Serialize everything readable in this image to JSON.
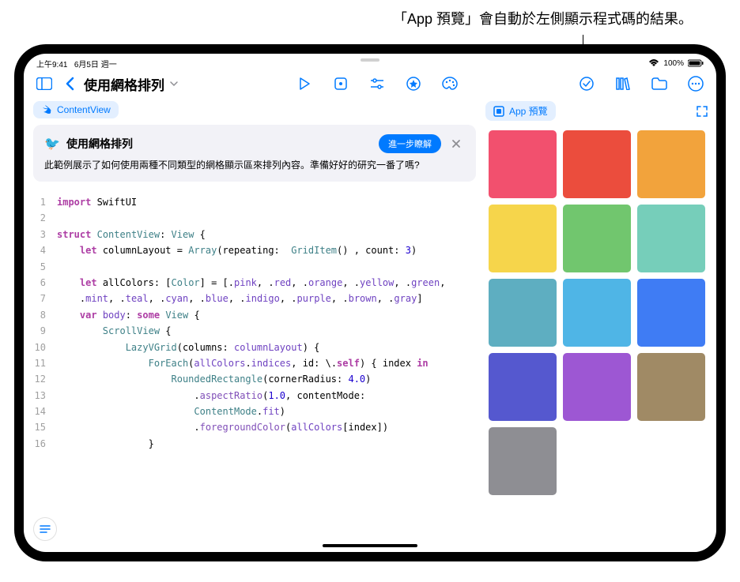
{
  "caption": "「App 預覽」會自動於左側顯示程式碼的結果。",
  "status_bar": {
    "time": "上午9:41",
    "date": "6月5日 週一",
    "battery": "100%"
  },
  "toolbar": {
    "title": "使用網格排列"
  },
  "chips": {
    "content_view": "ContentView",
    "app_preview": "App 預覽"
  },
  "intro": {
    "title": "使用網格排列",
    "learn_more": "進一步瞭解",
    "description": "此範例展示了如何使用兩種不同類型的網格顯示區來排列內容。準備好好的研究一番了嗎?"
  },
  "code_lines": [
    {
      "n": 1,
      "html": "<span class='kw'>import</span> SwiftUI"
    },
    {
      "n": 2,
      "html": ""
    },
    {
      "n": 3,
      "html": "<span class='kw'>struct</span> <span class='type'>ContentView</span>: <span class='type'>View</span> {"
    },
    {
      "n": 4,
      "html": "    <span class='kw'>let</span> columnLayout = <span class='type'>Array</span>(repeating:  <span class='type'>GridItem</span>() , count: <span class='num'>3</span>)"
    },
    {
      "n": 5,
      "html": ""
    },
    {
      "n": 6,
      "html": "    <span class='kw'>let</span> allColors: [<span class='type'>Color</span>] = [.<span class='enum'>pink</span>, .<span class='enum'>red</span>, .<span class='enum'>orange</span>, .<span class='enum'>yellow</span>, .<span class='enum'>green</span>,"
    },
    {
      "n": 7,
      "html": "    .<span class='enum'>mint</span>, .<span class='enum'>teal</span>, .<span class='enum'>cyan</span>, .<span class='enum'>blue</span>, .<span class='enum'>indigo</span>, .<span class='enum'>purple</span>, .<span class='enum'>brown</span>, .<span class='enum'>gray</span>]"
    },
    {
      "n": 8,
      "html": "    <span class='kw'>var</span> <span class='prop'>body</span>: <span class='kw'>some</span> <span class='type'>View</span> {"
    },
    {
      "n": 9,
      "html": "        <span class='type'>ScrollView</span> {"
    },
    {
      "n": 10,
      "html": "            <span class='type'>LazyVGrid</span>(columns: <span class='prop'>columnLayout</span>) {"
    },
    {
      "n": 11,
      "html": "                <span class='type'>ForEach</span>(<span class='prop'>allColors</span>.<span class='prop'>indices</span>, id: \\.<span class='kw'>self</span>) { index <span class='kw'>in</span>"
    },
    {
      "n": 12,
      "html": "                    <span class='type'>RoundedRectangle</span>(cornerRadius: <span class='num'>4.0</span>)"
    },
    {
      "n": 13,
      "html": "                        .<span class='method'>aspectRatio</span>(<span class='num'>1.0</span>, contentMode:"
    },
    {
      "n": 14,
      "html": "                        <span class='type'>ContentMode</span>.<span class='enum'>fit</span>)"
    },
    {
      "n": 15,
      "html": "                        .<span class='method'>foregroundColor</span>(<span class='prop'>allColors</span>[index])"
    },
    {
      "n": 16,
      "html": "                }"
    }
  ],
  "preview_colors": [
    "#f2506e",
    "#eb4d3d",
    "#f2a33c",
    "#f6d54b",
    "#71c66e",
    "#76ceba",
    "#5eaec1",
    "#4fb5e6",
    "#3f7cf4",
    "#5558cf",
    "#9d57d3",
    "#a08a65",
    "#8e8e93"
  ]
}
